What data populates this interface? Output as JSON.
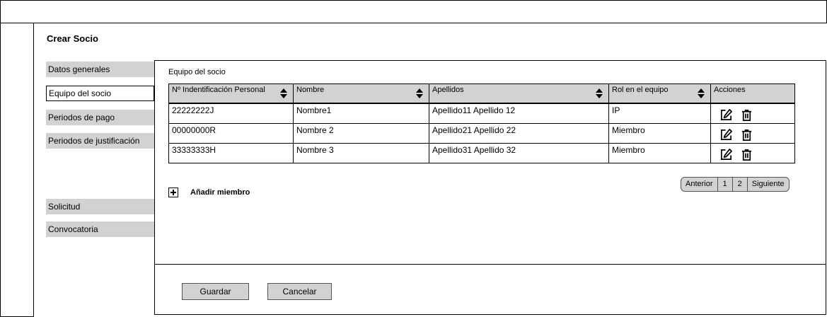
{
  "page": {
    "title": "Crear Socio"
  },
  "sidebar": {
    "items": [
      {
        "label": "Datos generales"
      },
      {
        "label": "Equipo del socio"
      },
      {
        "label": "Periodos de pago"
      },
      {
        "label": "Periodos de justificación"
      },
      {
        "label": "Solicitud"
      },
      {
        "label": "Convocatoria"
      }
    ]
  },
  "section": {
    "title": "Equipo del socio"
  },
  "table": {
    "headers": [
      "Nº Indentificación Personal",
      "Nombre",
      "Apellidos",
      "Rol en el equipo",
      "Acciones"
    ],
    "rows": [
      {
        "id": "22222222J",
        "nombre": "Nombre1",
        "apellidos": "Apellido11 Apellido 12",
        "rol": "IP"
      },
      {
        "id": "00000000R",
        "nombre": "Nombre 2",
        "apellidos": "Apellido21 Apellido 22",
        "rol": "Miembro"
      },
      {
        "id": "33333333H",
        "nombre": "Nombre 3",
        "apellidos": "Apellido31 Apellido 32",
        "rol": "Miembro"
      }
    ]
  },
  "actions": {
    "add_member": "Añadir miembro"
  },
  "pagination": {
    "prev": "Anterior",
    "page1": "1",
    "page2": "2",
    "next": "Siguiente"
  },
  "buttons": {
    "save": "Guardar",
    "cancel": "Cancelar"
  }
}
